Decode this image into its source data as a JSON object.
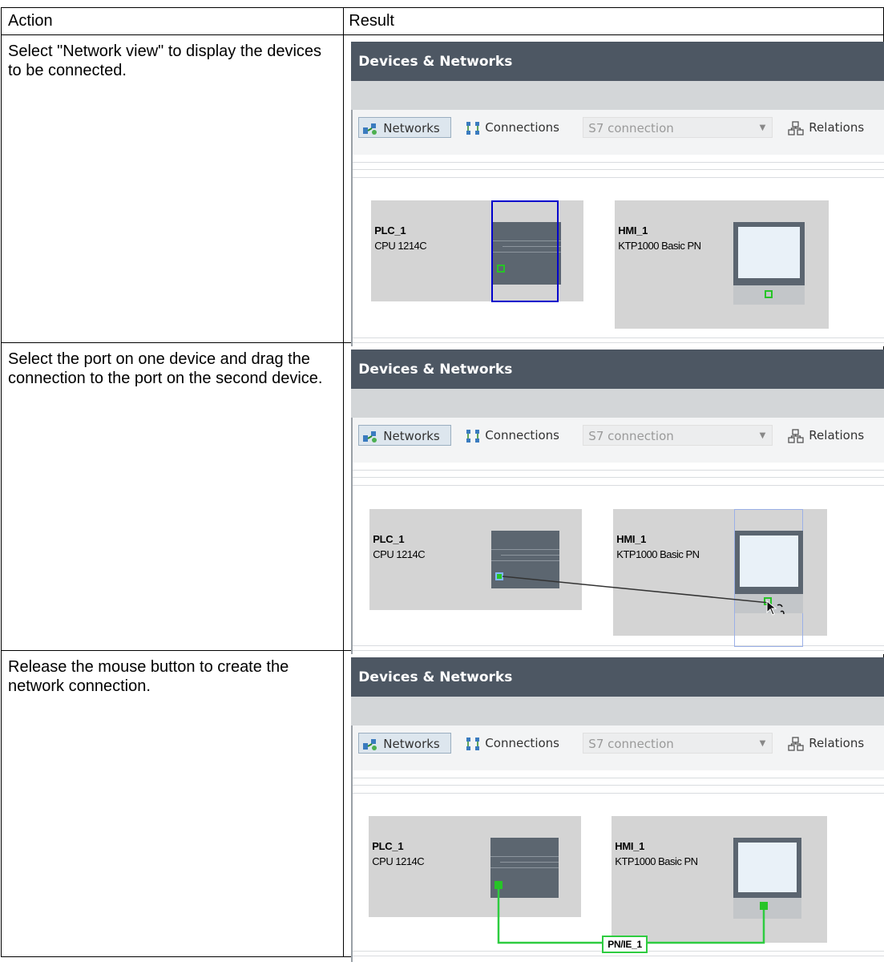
{
  "table": {
    "headers": {
      "action": "Action",
      "result": "Result"
    },
    "rows": [
      {
        "action": "Select \"Network view\" to display the devices to be connected."
      },
      {
        "action": "Select the port on one device and drag the connection to the port on the second device."
      },
      {
        "action": "Release the mouse button to create the network connection."
      }
    ]
  },
  "screenshot": {
    "title": "Devices & Networks",
    "toolbar": {
      "networks": "Networks",
      "connections": "Connections",
      "connection_type": "S7 connection",
      "relations": "Relations"
    },
    "plc": {
      "name": "PLC_1",
      "type": "CPU 1214C"
    },
    "hmi": {
      "name": "HMI_1",
      "type": "KTP1000 Basic PN"
    },
    "network_label": "PN/IE_1"
  },
  "colors": {
    "titlebar": "#4d5763",
    "selection_blue": "#0000cc",
    "port_green": "#27c427",
    "network_line": "#2ecc40"
  }
}
